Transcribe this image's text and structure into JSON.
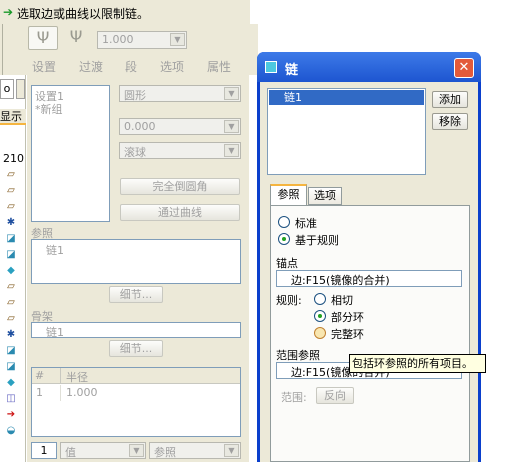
{
  "prompt": {
    "text": "选取边或曲线以限制链。"
  },
  "dashboard": {
    "value": "1.000",
    "tabs": [
      "设置",
      "过渡",
      "段",
      "选项",
      "属性"
    ]
  },
  "left_strip": {
    "tab_o": "o",
    "tab_display": "显示",
    "value_210": "210"
  },
  "sets_panel": {
    "sets": [
      "设置1",
      "*新组"
    ],
    "shape_select": "圆形",
    "value_field": "0.000",
    "ball_select": "滚球",
    "full_round_btn": "完全倒圆角",
    "through_curve_btn": "通过曲线",
    "references_label": "参照",
    "references_item": "链1",
    "details_btn1": "细节...",
    "skeleton_label": "骨架",
    "skeleton_item": "链1",
    "details_btn2": "细节...",
    "radius_table": {
      "headers": [
        "#",
        "半径"
      ],
      "rows": [
        [
          "1",
          "1.000"
        ]
      ]
    },
    "bottom_num": "1",
    "bottom_value_select": "值",
    "bottom_ref_select": "参照"
  },
  "dialog": {
    "title": "链",
    "list_items": [
      "链1"
    ],
    "add_btn": "添加",
    "remove_btn": "移除",
    "tabs": [
      "参照",
      "选项"
    ],
    "radio_standard": "标准",
    "radio_rule_based": "基于规则",
    "anchor_label": "锚点",
    "anchor_value": "边:F15(镜像的合并)",
    "rules_label": "规则:",
    "rule_tangent": "相切",
    "rule_partial_loop": "部分环",
    "rule_full_loop": "完整环",
    "extent_label": "范围参照",
    "extent_value": "边:F15(镜像的合并)",
    "tooltip": "包括环参照的所有项目。",
    "range_label": "范围:",
    "reverse_btn": "反向"
  },
  "colors": {
    "titlebar": "#2c63d9",
    "close": "#e35a3a",
    "selection": "#316ac5",
    "panel": "#ece9d8",
    "orange_tab": "#f5b540"
  }
}
